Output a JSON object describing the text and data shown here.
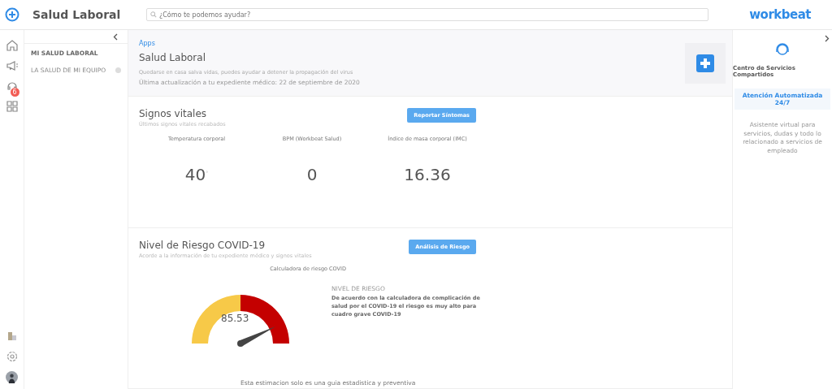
{
  "header": {
    "title": "Salud Laboral",
    "search": {
      "placeholder": "¿Cómo te podemos ayudar?"
    },
    "brand": "workbeat"
  },
  "rail": {
    "items": [
      {
        "kind": "home"
      },
      {
        "kind": "megaphone"
      },
      {
        "kind": "support",
        "badge": "6"
      },
      {
        "kind": "grid"
      }
    ],
    "bottom": [
      {
        "kind": "building"
      },
      {
        "kind": "settings"
      },
      {
        "kind": "avatar"
      }
    ]
  },
  "submenu": {
    "items": [
      {
        "label": "MI SALUD LABORAL",
        "selected": true,
        "has_dot": false
      },
      {
        "label": "LA SALUD DE MI EQUIPO",
        "selected": false,
        "has_dot": true
      }
    ]
  },
  "banner": {
    "breadcrumb": "Apps",
    "title": "Salud Laboral",
    "subtitle": "Quedarse en casa salva vidas, puedes ayudar a detener la propagación del virus",
    "updated": "Última actualización a tu expediente médico: 22 de septiembre de 2020"
  },
  "vitals": {
    "title": "Signos vitales",
    "subtitle": "Últimos signos vitales recabados",
    "button": "Reportar Síntomas",
    "items": [
      {
        "label": "Temperatura corporal",
        "value": "40",
        "unit": "°"
      },
      {
        "label": "BPM (Workbeat Salud)",
        "value": "0"
      },
      {
        "label": "Índice de masa corporal (IMC)",
        "value": "16.36"
      }
    ]
  },
  "risk": {
    "title": "Nivel de Riesgo COVID-19",
    "subtitle": "Acorde a la información de tu expediente médico y signos vitales",
    "button": "Análisis de Riesgo",
    "calc_title": "Calculadora de riesgo COVID",
    "gauge": {
      "value": "85.53"
    },
    "level_label": "NIVEL DE RIESGO",
    "description": "De acuerdo con la calculadora de complicación de salud por el COVID-19 el riesgo es muy alto para cuadro grave COVID-19",
    "footnote": "Esta estimacion solo es una guia estadistica y preventiva"
  },
  "right_panel": {
    "title": "Centro de Servicios Compartidos",
    "button": "Atención Automatizada 24/7",
    "description": "Asistente virtual para servicios, dudas y todo lo relacionado a servicios de empleado"
  }
}
